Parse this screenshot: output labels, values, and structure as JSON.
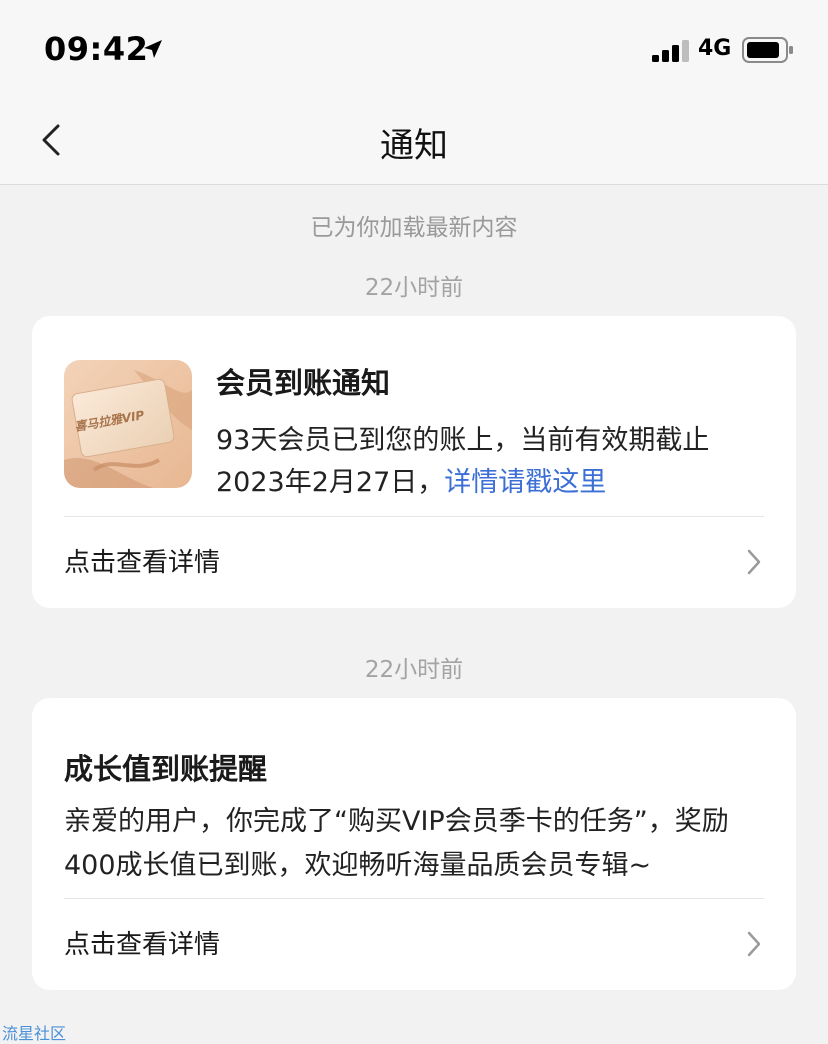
{
  "status_bar": {
    "time": "09:42",
    "network": "4G",
    "icons": [
      "location-arrow-icon",
      "signal-icon",
      "battery-icon"
    ]
  },
  "nav": {
    "title": "通知",
    "back_icon": "chevron-left-icon"
  },
  "feed": {
    "loaded_hint": "已为你加载最新内容",
    "notifications": [
      {
        "timestamp": "22小时前",
        "title": "会员到账通知",
        "body": "93天会员已到您的账上，当前有效期截止2023年2月27日，",
        "link_text": "详情请戳这里",
        "thumbnail_text": "喜马拉雅VIP",
        "action_label": "点击查看详情"
      },
      {
        "timestamp": "22小时前",
        "title": "成长值到账提醒",
        "body": "亲爱的用户，你完成了“购买VIP会员季卡的任务”，奖励400成长值已到账，欢迎畅听海量品质会员专辑~",
        "action_label": "点击查看详情"
      }
    ]
  },
  "watermark": "流星社区",
  "colors": {
    "background": "#f2f2f2",
    "card": "#ffffff",
    "link": "#3c6fd6",
    "muted_text": "#999999"
  }
}
